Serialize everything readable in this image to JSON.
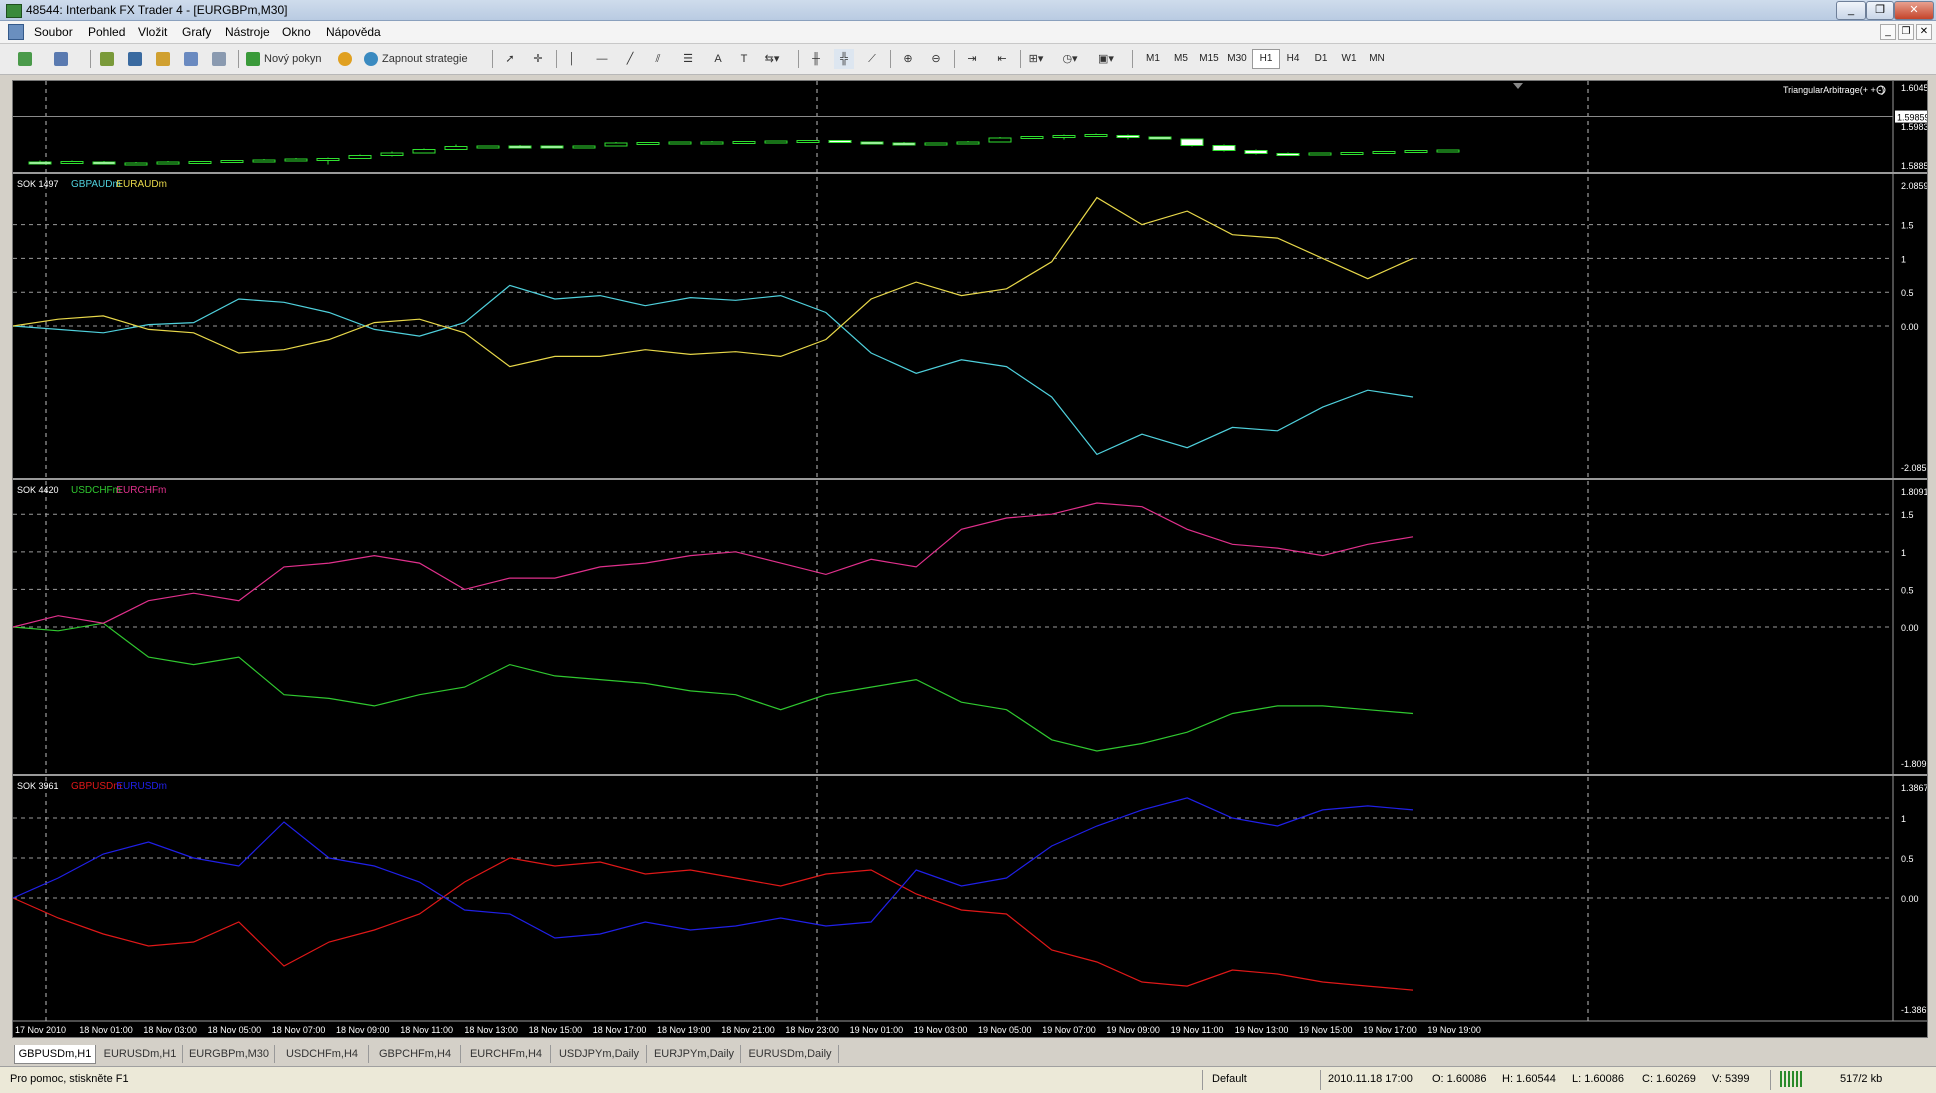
{
  "window": {
    "title": "48544: Interbank FX Trader 4 - [EURGBPm,M30]",
    "buttons": [
      "_",
      "❐",
      "✕"
    ]
  },
  "menu": {
    "items": [
      "Soubor",
      "Pohled",
      "Vložit",
      "Grafy",
      "Nástroje",
      "Okno",
      "Nápověda"
    ],
    "mdi_buttons": [
      "_",
      "❐",
      "✕"
    ]
  },
  "toolbar": {
    "new_order": "Nový pokyn",
    "toggle_strategies": "Zapnout strategie",
    "timeframes": [
      "M1",
      "M5",
      "M15",
      "M30",
      "H1",
      "H4",
      "D1",
      "W1",
      "MN"
    ],
    "active_timeframe": "H1",
    "text_tool": "A",
    "text_label_tool": "T"
  },
  "chart": {
    "indicator_label": "TriangularArbitrage(+ + -)",
    "price_axis": [
      "1.60450",
      "1.59859",
      "1.59830",
      "1.58850"
    ],
    "current_price": "1.59859",
    "panels": [
      {
        "label": "SOK 1497",
        "series_names": [
          "GBPAUDm",
          "EURAUDm"
        ],
        "series_colors": [
          "#4fd0dc",
          "#e8d84a"
        ],
        "axis_labels": [
          "2.0859",
          "1.5",
          "1",
          "0.5",
          "0.00",
          "-2.0859"
        ]
      },
      {
        "label": "SOK 4420",
        "series_names": [
          "USDCHFm",
          "EURCHFm"
        ],
        "series_colors": [
          "#30c830",
          "#e0308c"
        ],
        "axis_labels": [
          "1.8091",
          "1.5",
          "1",
          "0.5",
          "0.00",
          "-1.8091"
        ]
      },
      {
        "label": "SOK 3961",
        "series_names": [
          "GBPUSDm",
          "EURUSDm"
        ],
        "series_colors": [
          "#e01818",
          "#2020e8"
        ],
        "axis_labels": [
          "1.3867",
          "1",
          "0.5",
          "0.00",
          "-1.3867"
        ]
      }
    ],
    "time_labels": [
      "17 Nov 2010",
      "18 Nov 01:00",
      "18 Nov 03:00",
      "18 Nov 05:00",
      "18 Nov 07:00",
      "18 Nov 09:00",
      "18 Nov 11:00",
      "18 Nov 13:00",
      "18 Nov 15:00",
      "18 Nov 17:00",
      "18 Nov 19:00",
      "18 Nov 21:00",
      "18 Nov 23:00",
      "19 Nov 01:00",
      "19 Nov 03:00",
      "19 Nov 05:00",
      "19 Nov 07:00",
      "19 Nov 09:00",
      "19 Nov 11:00",
      "19 Nov 13:00",
      "19 Nov 15:00",
      "19 Nov 17:00",
      "19 Nov 19:00"
    ]
  },
  "chart_data": [
    {
      "type": "candlestick",
      "title": "EURGBPm,M30",
      "ylim": [
        1.5885,
        1.6045
      ],
      "candles": [
        {
          "o": 1.5895,
          "h": 1.5898,
          "l": 1.5891,
          "c": 1.5893
        },
        {
          "o": 1.5894,
          "h": 1.5898,
          "l": 1.5892,
          "c": 1.5896
        },
        {
          "o": 1.5895,
          "h": 1.5897,
          "l": 1.5891,
          "c": 1.5892
        },
        {
          "o": 1.5892,
          "h": 1.5895,
          "l": 1.589,
          "c": 1.5893
        },
        {
          "o": 1.5892,
          "h": 1.5897,
          "l": 1.5891,
          "c": 1.5895
        },
        {
          "o": 1.5894,
          "h": 1.5897,
          "l": 1.5892,
          "c": 1.5896
        },
        {
          "o": 1.5895,
          "h": 1.5899,
          "l": 1.5894,
          "c": 1.5898
        },
        {
          "o": 1.5897,
          "h": 1.5901,
          "l": 1.5895,
          "c": 1.5899
        },
        {
          "o": 1.5898,
          "h": 1.5903,
          "l": 1.5897,
          "c": 1.5901
        },
        {
          "o": 1.59,
          "h": 1.5904,
          "l": 1.589,
          "c": 1.5902
        },
        {
          "o": 1.5902,
          "h": 1.591,
          "l": 1.5901,
          "c": 1.5908
        },
        {
          "o": 1.5908,
          "h": 1.5916,
          "l": 1.5906,
          "c": 1.5913
        },
        {
          "o": 1.5913,
          "h": 1.5922,
          "l": 1.5912,
          "c": 1.592
        },
        {
          "o": 1.592,
          "h": 1.593,
          "l": 1.5919,
          "c": 1.5926
        },
        {
          "o": 1.5926,
          "h": 1.5928,
          "l": 1.5922,
          "c": 1.5927
        },
        {
          "o": 1.5927,
          "h": 1.5929,
          "l": 1.5924,
          "c": 1.5926
        },
        {
          "o": 1.5927,
          "h": 1.5928,
          "l": 1.5922,
          "c": 1.5923
        },
        {
          "o": 1.5923,
          "h": 1.5928,
          "l": 1.5922,
          "c": 1.5927
        },
        {
          "o": 1.5927,
          "h": 1.5935,
          "l": 1.5926,
          "c": 1.5933
        },
        {
          "o": 1.5933,
          "h": 1.5935,
          "l": 1.593,
          "c": 1.5934
        },
        {
          "o": 1.5933,
          "h": 1.5936,
          "l": 1.5931,
          "c": 1.5935
        },
        {
          "o": 1.5934,
          "h": 1.5937,
          "l": 1.5932,
          "c": 1.5935
        },
        {
          "o": 1.5935,
          "h": 1.5937,
          "l": 1.5933,
          "c": 1.5936
        },
        {
          "o": 1.5936,
          "h": 1.5938,
          "l": 1.5934,
          "c": 1.5937
        },
        {
          "o": 1.5937,
          "h": 1.5939,
          "l": 1.5935,
          "c": 1.5938
        },
        {
          "o": 1.5938,
          "h": 1.5939,
          "l": 1.5934,
          "c": 1.5935
        },
        {
          "o": 1.5935,
          "h": 1.5936,
          "l": 1.5931,
          "c": 1.5933
        },
        {
          "o": 1.5933,
          "h": 1.5935,
          "l": 1.5929,
          "c": 1.593
        },
        {
          "o": 1.593,
          "h": 1.5934,
          "l": 1.5929,
          "c": 1.5933
        },
        {
          "o": 1.5933,
          "h": 1.5937,
          "l": 1.5932,
          "c": 1.5935
        },
        {
          "o": 1.5935,
          "h": 1.5945,
          "l": 1.5934,
          "c": 1.5943
        },
        {
          "o": 1.5943,
          "h": 1.5947,
          "l": 1.5942,
          "c": 1.5946
        },
        {
          "o": 1.5946,
          "h": 1.595,
          "l": 1.594,
          "c": 1.5948
        },
        {
          "o": 1.5948,
          "h": 1.5952,
          "l": 1.5947,
          "c": 1.595
        },
        {
          "o": 1.5948,
          "h": 1.595,
          "l": 1.594,
          "c": 1.5945
        },
        {
          "o": 1.5945,
          "h": 1.5946,
          "l": 1.594,
          "c": 1.5942
        },
        {
          "o": 1.5941,
          "h": 1.5942,
          "l": 1.5926,
          "c": 1.5928
        },
        {
          "o": 1.5928,
          "h": 1.593,
          "l": 1.5916,
          "c": 1.5918
        },
        {
          "o": 1.5918,
          "h": 1.592,
          "l": 1.591,
          "c": 1.5912
        },
        {
          "o": 1.5912,
          "h": 1.5914,
          "l": 1.5909,
          "c": 1.5911
        },
        {
          "o": 1.5911,
          "h": 1.5914,
          "l": 1.5909,
          "c": 1.5913
        },
        {
          "o": 1.5912,
          "h": 1.5915,
          "l": 1.591,
          "c": 1.5914
        },
        {
          "o": 1.5914,
          "h": 1.5917,
          "l": 1.5912,
          "c": 1.5916
        },
        {
          "o": 1.5916,
          "h": 1.5919,
          "l": 1.5915,
          "c": 1.5918
        },
        {
          "o": 1.5918,
          "h": 1.592,
          "l": 1.5917,
          "c": 1.5919
        }
      ]
    },
    {
      "type": "line",
      "title": "SOK 1497",
      "ylim": [
        -2.0859,
        2.0859
      ],
      "series": [
        {
          "name": "GBPAUDm",
          "values": [
            0,
            -0.05,
            -0.1,
            0.02,
            0.05,
            0.4,
            0.35,
            0.2,
            -0.05,
            -0.15,
            0.05,
            0.6,
            0.4,
            0.45,
            0.3,
            0.42,
            0.38,
            0.45,
            0.2,
            -0.4,
            -0.7,
            -0.5,
            -0.6,
            -1.05,
            -1.9,
            -1.6,
            -1.8,
            -1.5,
            -1.55,
            -1.2,
            -0.95,
            -1.05
          ]
        },
        {
          "name": "EURAUDm",
          "values": [
            0,
            0.1,
            0.15,
            -0.05,
            -0.1,
            -0.4,
            -0.35,
            -0.2,
            0.05,
            0.1,
            -0.1,
            -0.6,
            -0.45,
            -0.45,
            -0.35,
            -0.42,
            -0.38,
            -0.45,
            -0.2,
            0.4,
            0.65,
            0.45,
            0.55,
            0.95,
            1.9,
            1.5,
            1.7,
            1.35,
            1.3,
            1.0,
            0.7,
            1.0
          ]
        }
      ]
    },
    {
      "type": "line",
      "title": "SOK 4420",
      "ylim": [
        -1.8091,
        1.8091
      ],
      "series": [
        {
          "name": "USDCHFm",
          "values": [
            0,
            -0.05,
            0.05,
            -0.4,
            -0.5,
            -0.4,
            -0.9,
            -0.95,
            -1.05,
            -0.9,
            -0.8,
            -0.5,
            -0.65,
            -0.7,
            -0.75,
            -0.85,
            -0.9,
            -1.1,
            -0.9,
            -0.8,
            -0.7,
            -1.0,
            -1.1,
            -1.5,
            -1.65,
            -1.55,
            -1.4,
            -1.15,
            -1.05,
            -1.05,
            -1.1,
            -1.15
          ]
        },
        {
          "name": "EURCHFm",
          "values": [
            0,
            0.15,
            0.05,
            0.35,
            0.45,
            0.35,
            0.8,
            0.85,
            0.95,
            0.85,
            0.5,
            0.65,
            0.65,
            0.8,
            0.85,
            0.95,
            1.0,
            0.85,
            0.7,
            0.9,
            0.8,
            1.3,
            1.45,
            1.5,
            1.65,
            1.6,
            1.3,
            1.1,
            1.05,
            0.95,
            1.1,
            1.2
          ]
        }
      ]
    },
    {
      "type": "line",
      "title": "SOK 3961",
      "ylim": [
        -1.3867,
        1.3867
      ],
      "series": [
        {
          "name": "GBPUSDm",
          "values": [
            0,
            -0.25,
            -0.45,
            -0.6,
            -0.55,
            -0.3,
            -0.85,
            -0.55,
            -0.4,
            -0.2,
            0.2,
            0.5,
            0.4,
            0.45,
            0.3,
            0.35,
            0.25,
            0.15,
            0.3,
            0.35,
            0.05,
            -0.15,
            -0.2,
            -0.65,
            -0.8,
            -1.05,
            -1.1,
            -0.9,
            -0.95,
            -1.05,
            -1.1,
            -1.15
          ]
        },
        {
          "name": "EURUSDm",
          "values": [
            0,
            0.25,
            0.55,
            0.7,
            0.5,
            0.4,
            0.95,
            0.5,
            0.4,
            0.2,
            -0.15,
            -0.2,
            -0.5,
            -0.45,
            -0.3,
            -0.4,
            -0.35,
            -0.25,
            -0.35,
            -0.3,
            0.35,
            0.15,
            0.25,
            0.65,
            0.9,
            1.1,
            1.25,
            1.0,
            0.9,
            1.1,
            1.15,
            1.1
          ]
        }
      ]
    }
  ],
  "tabs": [
    "GBPUSDm,H1",
    "EURUSDm,H1",
    "EURGBPm,M30",
    "USDCHFm,H4",
    "GBPCHFm,H4",
    "EURCHFm,H4",
    "USDJPYm,Daily",
    "EURJPYm,Daily",
    "EURUSDm,Daily"
  ],
  "active_tab": "GBPUSDm,H1",
  "status": {
    "help": "Pro pomoc, stiskněte F1",
    "profile": "Default",
    "datetime": "2010.11.18 17:00",
    "open": "O: 1.60086",
    "high": "H: 1.60544",
    "low": "L: 1.60086",
    "close": "C: 1.60269",
    "volume": "V: 5399",
    "traffic": "517/2 kb"
  }
}
